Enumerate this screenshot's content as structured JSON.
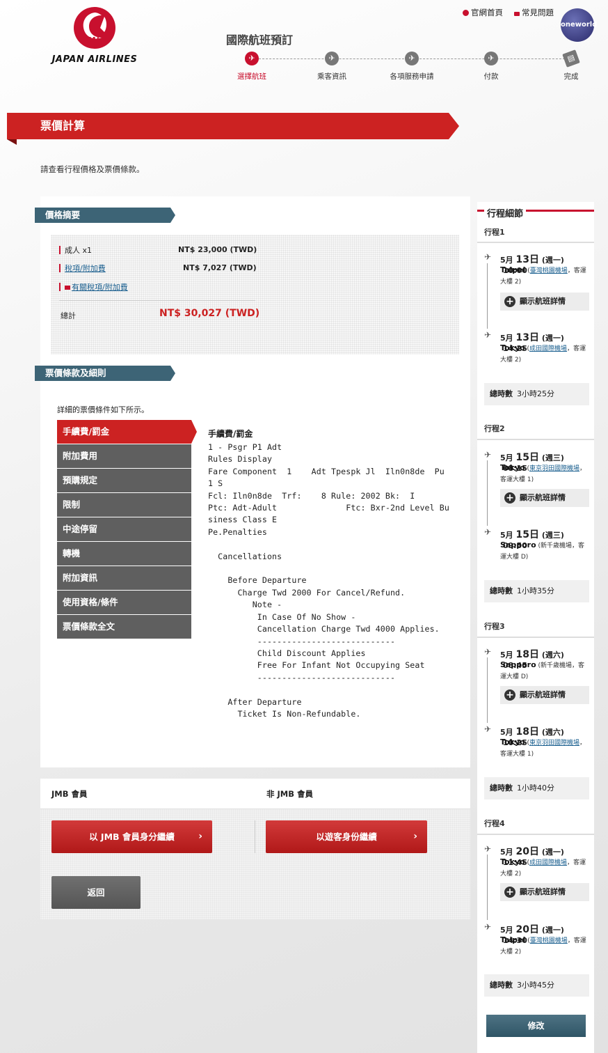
{
  "header": {
    "brand": "JAPAN AIRLINES",
    "logo_text": "JAL",
    "links": [
      "官網首頁",
      "常見問題"
    ],
    "alliance": "oneworld",
    "booking_title": "國際航班預訂",
    "steps": [
      "選擇航班",
      "乘客資訊",
      "各項服務申請",
      "付款",
      "完成"
    ],
    "active_step": 0
  },
  "page": {
    "title": "票價計算",
    "intro": "請查看行程價格及票價條款。"
  },
  "summary": {
    "tag": "價格摘要",
    "adult_label": "成人 x1",
    "adult_price": "NT$ 23,000 (TWD)",
    "tax_label": "稅項/附加費",
    "tax_price": "NT$ 7,027 (TWD)",
    "tax_link": "有關稅項/附加費",
    "total_label": "總計",
    "total_price": "NT$ 30,027 (TWD)"
  },
  "rules": {
    "tag": "票價條款及細則",
    "intro": "詳細的票價條件如下所示。",
    "menu": [
      "手續費/罰金",
      "附加費用",
      "預購規定",
      "限制",
      "中途停留",
      "轉機",
      "附加資訊",
      "使用資格/條件",
      "票價條款全文"
    ],
    "active_index": 0,
    "heading": "手續費/罰金",
    "text": "1 - Psgr P1 Adt\nRules Display\nFare Component  1    Adt Tpespk Jl  Iln0n8de  Pu\n1 S\nFcl: Iln0n8de  Trf:    8 Rule: 2002 Bk:  I\nPtc: Adt-Adult              Ftc: Bxr-2nd Level Bu\nsiness Class E\nPe.Penalties\n\n  Cancellations\n\n    Before Departure\n      Charge Twd 2000 For Cancel/Refund.\n         Note -\n          In Case Of No Show -\n          Cancellation Charge Twd 4000 Applies.\n          ----------------------------\n          Child Discount Applies\n          Free For Infant Not Occupying Seat\n          ----------------------------\n\n    After Departure\n      Ticket Is Non-Refundable."
  },
  "actions": {
    "jmb_label": "JMB 會員",
    "non_jmb_label": "非 JMB 會員",
    "jmb_button": "以 JMB 會員身分繼續",
    "guest_button": "以遊客身份繼續",
    "back_button": "返回"
  },
  "sidebar": {
    "title": "行程細節",
    "details_label": "顯示航班詳情",
    "duration_label": "總時數",
    "modify_button": "修改",
    "legs": [
      {
        "title": "行程1",
        "dep": {
          "month": "5月",
          "day": "13日",
          "weekday": "(週一)",
          "time": "10:00",
          "city": "Taipei",
          "airport": "臺灣桃園機場",
          "terminal": "客運大樓 2)"
        },
        "arr": {
          "month": "5月",
          "day": "13日",
          "weekday": "(週一)",
          "time": "14:25",
          "city": "Tokyo",
          "airport": "成田國際機場",
          "terminal": "客運大樓 2)"
        },
        "duration": "3小時25分"
      },
      {
        "title": "行程2",
        "dep": {
          "month": "5月",
          "day": "15日",
          "weekday": "(週三)",
          "time": "08:15",
          "city": "Tokyo",
          "airport": "東京羽田國際機場",
          "terminal": "客運大樓 1)"
        },
        "arr": {
          "month": "5月",
          "day": "15日",
          "weekday": "(週三)",
          "time": "09:50",
          "city": "Sapporo",
          "airport": "新千歲機場",
          "terminal": "客運大樓 D)"
        },
        "duration": "1小時35分"
      },
      {
        "title": "行程3",
        "dep": {
          "month": "5月",
          "day": "18日",
          "weekday": "(週六)",
          "time": "08:45",
          "city": "Sapporo",
          "airport": "新千歲機場",
          "terminal": "客運大樓 D)"
        },
        "arr": {
          "month": "5月",
          "day": "18日",
          "weekday": "(週六)",
          "time": "10:25",
          "city": "Tokyo",
          "airport": "東京羽田國際機場",
          "terminal": "客運大樓 1)"
        },
        "duration": "1小時40分"
      },
      {
        "title": "行程4",
        "dep": {
          "month": "5月",
          "day": "20日",
          "weekday": "(週一)",
          "time": "11:45",
          "city": "Tokyo",
          "airport": "成田國際機場",
          "terminal": "客運大樓 2)"
        },
        "arr": {
          "month": "5月",
          "day": "20日",
          "weekday": "(週一)",
          "time": "14:30",
          "city": "Taipei",
          "airport": "臺灣桃園機場",
          "terminal": "客運大樓 2)"
        },
        "duration": "3小時45分"
      }
    ]
  },
  "colors": {
    "brand_red": "#c8102e",
    "tag_blue": "#3d6476",
    "menu_grey": "#5f5f5f"
  }
}
